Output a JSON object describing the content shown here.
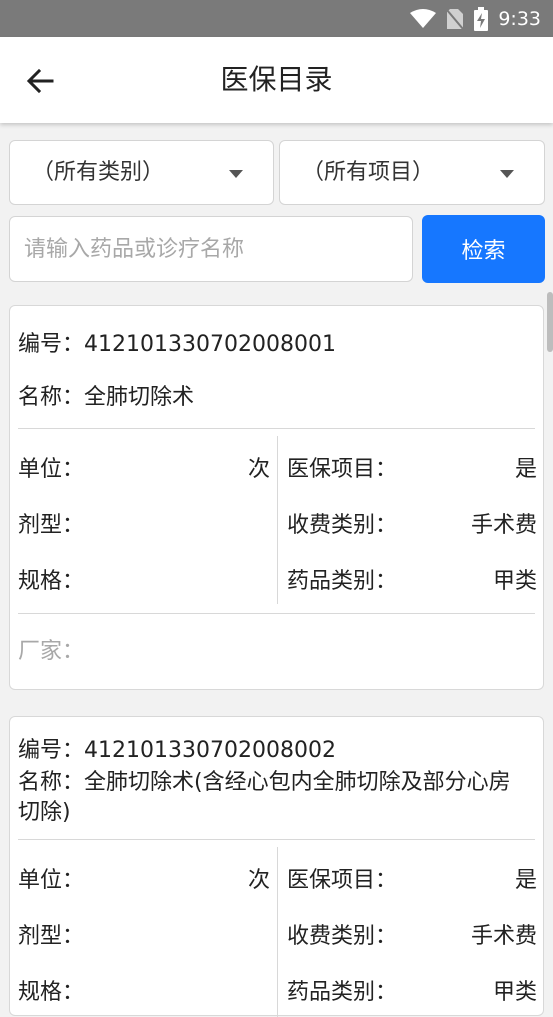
{
  "status": {
    "time": "9:33"
  },
  "header": {
    "title": "医保目录"
  },
  "filters": {
    "category": "（所有类别）",
    "item": "（所有项目）"
  },
  "search": {
    "placeholder": "请输入药品或诊疗名称",
    "button": "检索"
  },
  "labels": {
    "code": "编号：",
    "name": "名称：",
    "unit": "单位：",
    "insurance": "医保项目：",
    "dosage": "剂型：",
    "fee_type": "收费类别：",
    "spec": "规格：",
    "drug_type": "药品类别：",
    "maker": "厂家："
  },
  "cards": [
    {
      "code": "412101330702008001",
      "name": "全肺切除术",
      "unit": "次",
      "insurance": "是",
      "dosage": "",
      "fee_type": "手术费",
      "spec": "",
      "drug_type": "甲类",
      "maker": ""
    },
    {
      "code": "412101330702008002",
      "name": "全肺切除术(含经心包内全肺切除及部分心房切除)",
      "unit": "次",
      "insurance": "是",
      "dosage": "",
      "fee_type": "手术费",
      "spec": "",
      "drug_type": "甲类",
      "maker": ""
    }
  ]
}
